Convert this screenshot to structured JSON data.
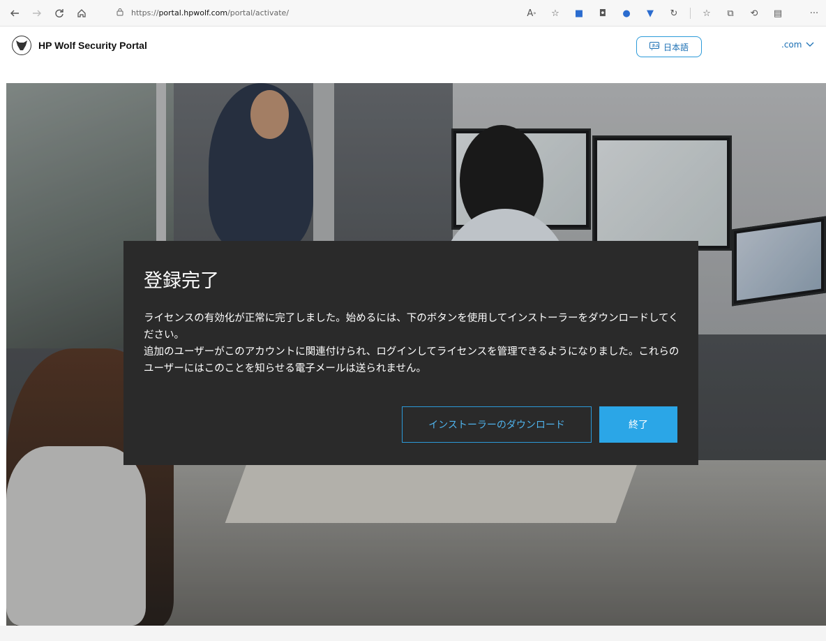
{
  "browser": {
    "url_prefix": "https://",
    "url_host": "portal.hpwolf.com",
    "url_path": "/portal/activate/",
    "more_label": "···"
  },
  "header": {
    "title": "HP Wolf Security Portal",
    "language_label": "日本語",
    "region_label": ".com"
  },
  "modal": {
    "title": "登録完了",
    "line1": "ライセンスの有効化が正常に完了しました。始めるには、下のボタンを使用してインストーラーをダウンロードしてください。",
    "line2": "追加のユーザーがこのアカウントに関連付けられ、ログインしてライセンスを管理できるようになりました。これらのユーザーにはこのことを知らせる電子メールは送られません。",
    "download_label": "インストーラーのダウンロード",
    "finish_label": "終了"
  },
  "colors": {
    "accent": "#2ba6e7",
    "modal_bg": "#2a2a2a"
  }
}
